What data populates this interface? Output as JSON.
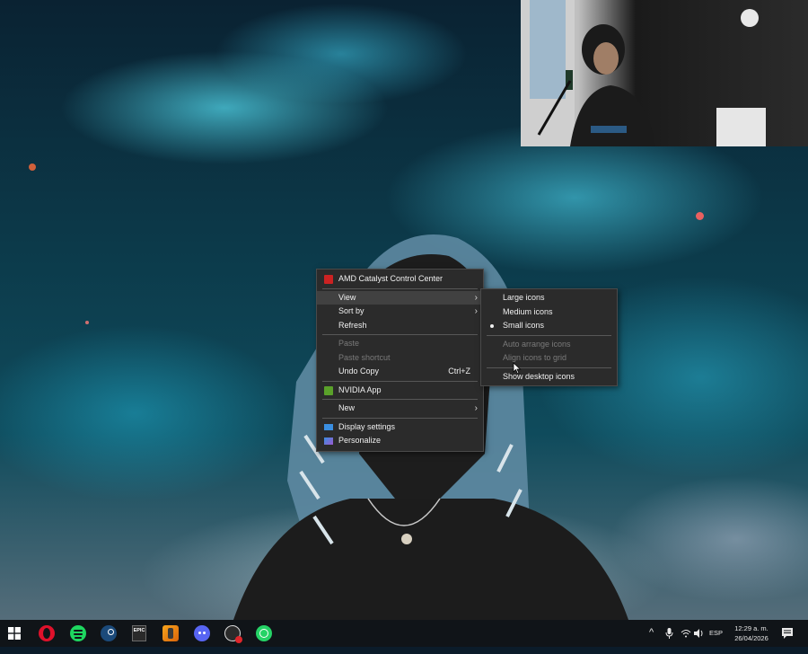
{
  "context_menu": {
    "items": [
      {
        "id": "amd",
        "label": "AMD Catalyst Control Center",
        "icon": "amd-icon"
      },
      {
        "id": "view",
        "label": "View",
        "submenu": true
      },
      {
        "id": "sort_by",
        "label": "Sort by",
        "submenu": true
      },
      {
        "id": "refresh",
        "label": "Refresh"
      },
      {
        "id": "paste",
        "label": "Paste",
        "disabled": true
      },
      {
        "id": "paste_shortcut",
        "label": "Paste shortcut",
        "disabled": true
      },
      {
        "id": "undo_copy",
        "label": "Undo Copy",
        "shortcut": "Ctrl+Z"
      },
      {
        "id": "nvidia",
        "label": "NVIDIA App",
        "icon": "nvidia-icon"
      },
      {
        "id": "new",
        "label": "New",
        "submenu": true
      },
      {
        "id": "display_settings",
        "label": "Display settings",
        "icon": "display-icon"
      },
      {
        "id": "personalize",
        "label": "Personalize",
        "icon": "personalize-icon"
      }
    ]
  },
  "view_submenu": {
    "items": [
      {
        "id": "large",
        "label": "Large icons"
      },
      {
        "id": "medium",
        "label": "Medium icons"
      },
      {
        "id": "small",
        "label": "Small icons",
        "checked": true
      },
      {
        "id": "auto_arrange",
        "label": "Auto arrange icons",
        "disabled": true
      },
      {
        "id": "align_grid",
        "label": "Align icons to grid",
        "disabled": true
      },
      {
        "id": "show_desktop",
        "label": "Show desktop icons"
      }
    ]
  },
  "taskbar": {
    "pinned": [
      "windows-start-icon",
      "opera-icon",
      "spotify-icon",
      "steam-icon",
      "epic-games-icon",
      "fl-studio-icon",
      "discord-icon",
      "obs-icon",
      "whatsapp-icon"
    ],
    "epic_label": "EPIC",
    "language": "ESP",
    "time": "12:29 a. m.",
    "date": "26/04/2026"
  },
  "colors": {
    "menu_bg": "#2b2b2b",
    "menu_hover": "#414141",
    "taskbar_bg": "#101418"
  }
}
